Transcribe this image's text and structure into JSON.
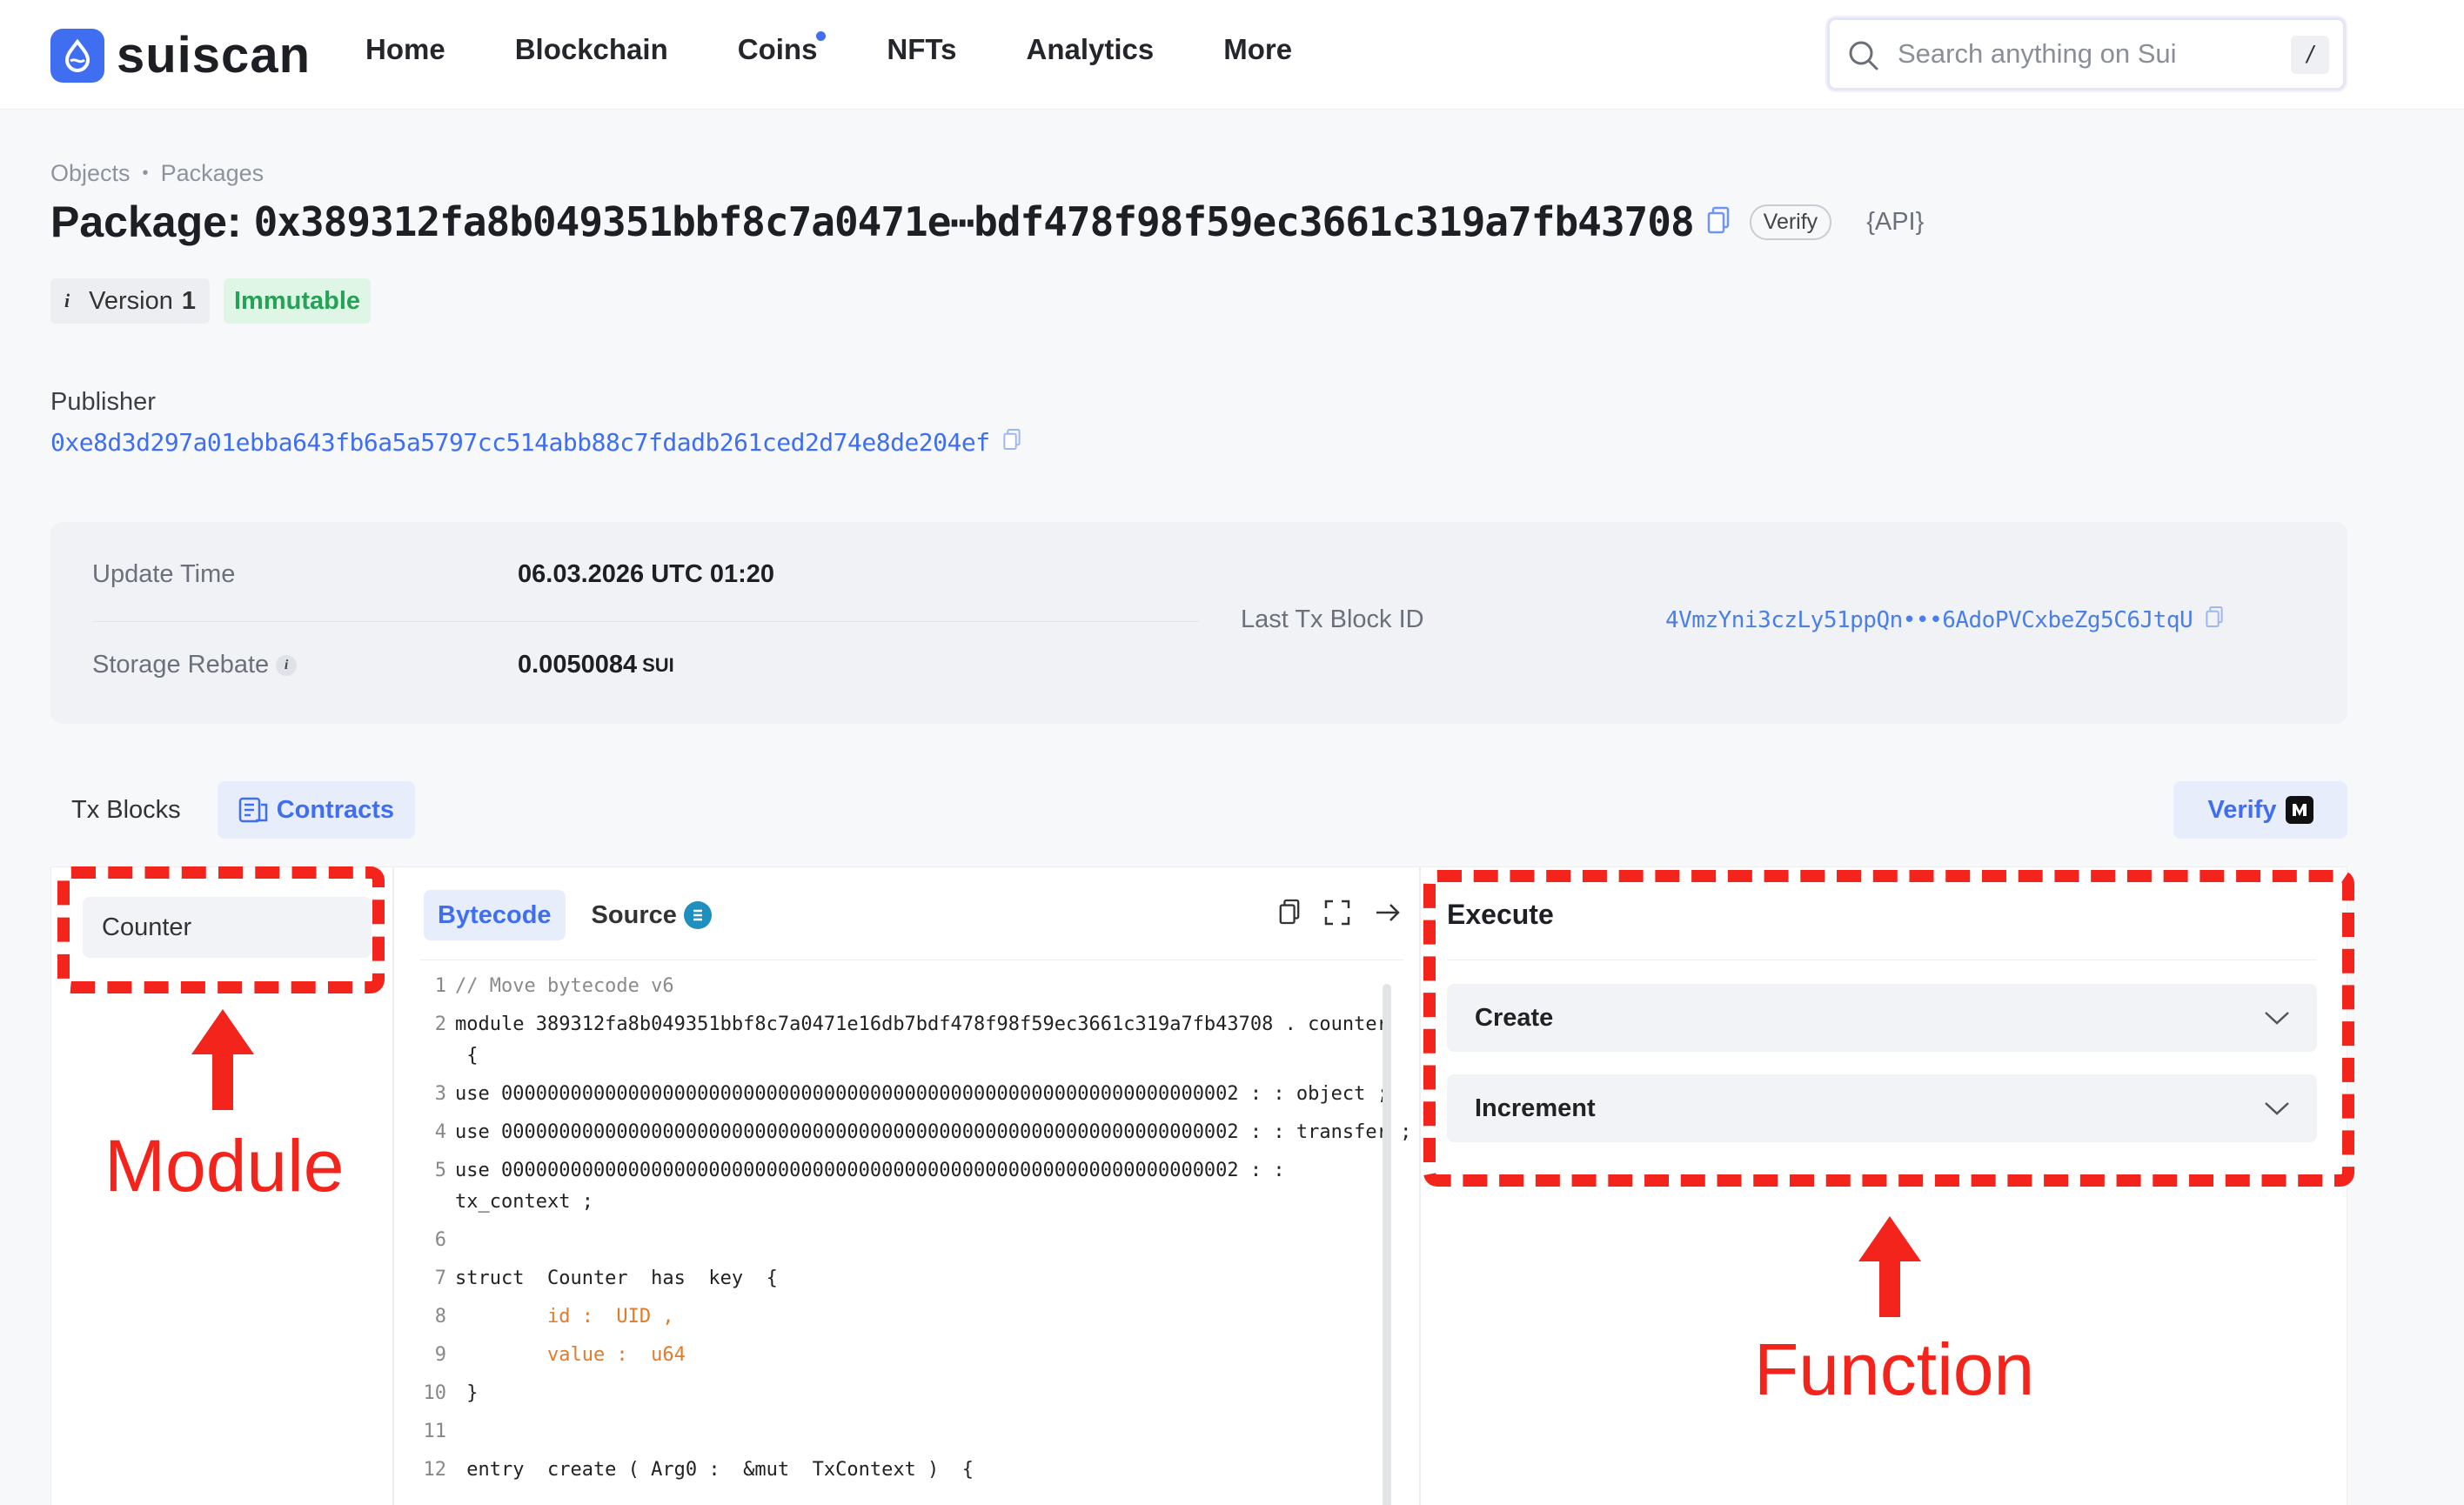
{
  "header": {
    "logo_text": "suiscan",
    "nav": [
      {
        "label": "Home"
      },
      {
        "label": "Blockchain"
      },
      {
        "label": "Coins",
        "dot": true
      },
      {
        "label": "NFTs"
      },
      {
        "label": "Analytics"
      },
      {
        "label": "More"
      }
    ],
    "search_placeholder": "Search anything on Sui",
    "search_shortcut": "/"
  },
  "breadcrumb": {
    "items": [
      "Objects",
      "Packages"
    ]
  },
  "title": {
    "prefix": "Package:",
    "hash": "0x389312fa8b049351bbf8c7a0471e⋯bdf478f98f59ec3661c319a7fb43708",
    "verify_pill": "Verify",
    "api_link": "{API}"
  },
  "badges": {
    "version_label": "Version",
    "version_number": "1",
    "status": "Immutable"
  },
  "publisher": {
    "label": "Publisher",
    "address": "0xe8d3d297a01ebba643fb6a5a5797cc514abb88c7fdadb261ced2d74e8de204ef"
  },
  "info": {
    "update_time_label": "Update Time",
    "update_time_value": "06.03.2026 UTC 01:20",
    "storage_rebate_label": "Storage Rebate",
    "storage_rebate_value": "0.0050084",
    "storage_rebate_unit": "SUI",
    "last_tx_label": "Last Tx Block ID",
    "last_tx_value": "4VmzYni3czLy51ppQn•••6AdoPVCxbeZg5C6JtqU"
  },
  "tabs": {
    "tx_blocks": "Tx Blocks",
    "contracts": "Contracts",
    "verify": "Verify"
  },
  "modules": {
    "items": [
      "Counter"
    ]
  },
  "code_panel": {
    "tab_bytecode": "Bytecode",
    "tab_source": "Source",
    "lines": [
      {
        "n": "1",
        "t": "// Move bytecode v6"
      },
      {
        "n": "2",
        "t": "module 389312fa8b049351bbf8c7a0471e16db7bdf478f98f59ec3661c319a7fb43708 . counter"
      },
      {
        "n": "",
        "t": " {"
      },
      {
        "n": "3",
        "t": "use 0000000000000000000000000000000000000000000000000000000000000002 : : object ;"
      },
      {
        "n": "4",
        "t": "use 0000000000000000000000000000000000000000000000000000000000000002 : : transfer ;"
      },
      {
        "n": "5",
        "t": "use 0000000000000000000000000000000000000000000000000000000000000002 : :"
      },
      {
        "n": "",
        "t": "tx_context ;"
      },
      {
        "n": "6",
        "t": ""
      },
      {
        "n": "7",
        "t": "struct  Counter  has  key  {"
      },
      {
        "n": "8",
        "t": "        id :  UID ,"
      },
      {
        "n": "9",
        "t": "        value :  u64"
      },
      {
        "n": "10",
        "t": " }"
      },
      {
        "n": "11",
        "t": ""
      },
      {
        "n": "12",
        "t": " entry  create ( Arg0 :  &mut  TxContext )  {"
      }
    ]
  },
  "execute_panel": {
    "title": "Execute",
    "functions": [
      "Create",
      "Increment"
    ]
  },
  "annotations": {
    "module_label": "Module",
    "function_label": "Function",
    "color": "#f2241c"
  },
  "colors": {
    "accent": "#3f6ff0",
    "success": "#25a256"
  }
}
